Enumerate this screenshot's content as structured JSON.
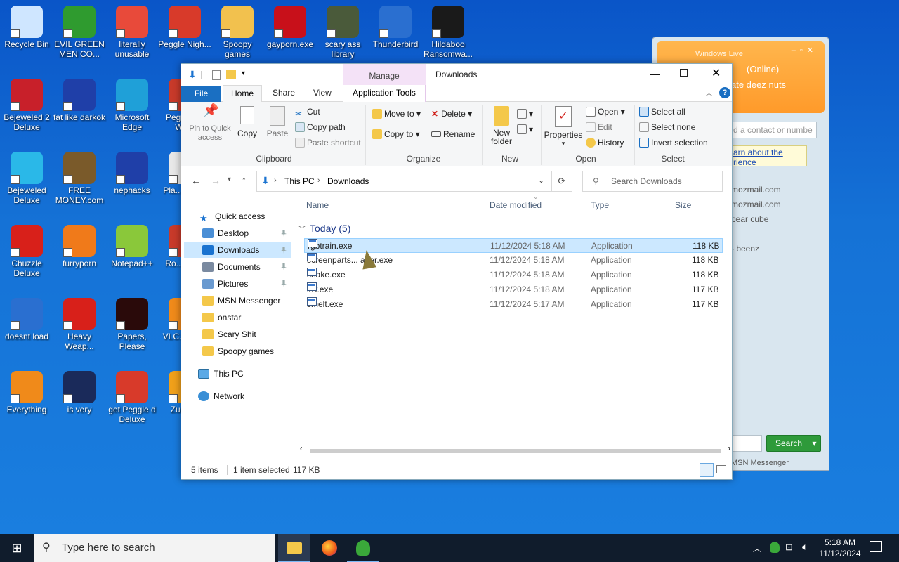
{
  "desktop": {
    "icons": [
      {
        "label": "Recycle Bin",
        "color": "#cfe6ff"
      },
      {
        "label": "EVIL GREEN MEN CO...",
        "color": "#2f9b2f"
      },
      {
        "label": "literally unusable",
        "color": "#e84a3a"
      },
      {
        "label": "Peggle Nigh...",
        "color": "#d83a2a"
      },
      {
        "label": "Spoopy games",
        "color": "#f2c14e"
      },
      {
        "label": "gayporn.exe",
        "color": "#c8101a"
      },
      {
        "label": "scary ass library",
        "color": "#4a5a3a"
      },
      {
        "label": "Thunderbird",
        "color": "#2a6fd0"
      },
      {
        "label": "Hildaboo Ransomwa...",
        "color": "#1a1a1a"
      },
      {
        "label": "Bejeweled 2 Deluxe",
        "color": "#c8202a"
      },
      {
        "label": "fat like darkok",
        "color": "#1f3fa8"
      },
      {
        "label": "Microsoft Edge",
        "color": "#1fa0d8"
      },
      {
        "label": "Peggl... of Wa...",
        "color": "#c83a2a"
      },
      {
        "label": "Bejeweled Deluxe",
        "color": "#2ab8e8"
      },
      {
        "label": "FREE MONEY.com",
        "color": "#7a5a2a"
      },
      {
        "label": "nephacks",
        "color": "#1f3fa8"
      },
      {
        "label": "Pla... Zon...",
        "color": "#e8e8e8"
      },
      {
        "label": "Chuzzle Deluxe",
        "color": "#d8201a"
      },
      {
        "label": "furryporn",
        "color": "#f07a1a"
      },
      {
        "label": "Notepad++",
        "color": "#8ac83a"
      },
      {
        "label": "Ro... Ma...",
        "color": "#c83a2a"
      },
      {
        "label": "doesnt load",
        "color": "#2a6fd0"
      },
      {
        "label": "Heavy Weap...",
        "color": "#d8201a"
      },
      {
        "label": "Papers, Please",
        "color": "#2a0a0a"
      },
      {
        "label": "VLC... pla...",
        "color": "#f08a1a"
      },
      {
        "label": "Everything",
        "color": "#f08a1a"
      },
      {
        "label": "is very",
        "color": "#1a2a5a"
      },
      {
        "label": "get Peggle d Deluxe",
        "color": "#d83a2a"
      },
      {
        "label": "Zuma...",
        "color": "#f0a01a"
      }
    ]
  },
  "msn": {
    "title": "Windows Live",
    "status": "(Online)",
    "personal_message": "ate deez nuts",
    "search_placeholder": "d a contact or numbe",
    "banner_line1": "arn about the",
    "banner_line2": "rience",
    "contacts": [
      "mozmail.com",
      "mozmail.com",
      "bear cube",
      "- beenz"
    ],
    "search_button": "Search",
    "footer": "MSN Messenger"
  },
  "explorer": {
    "title": "Downloads",
    "context_tab": "Manage",
    "tabs": [
      "File",
      "Home",
      "Share",
      "View",
      "Application Tools"
    ],
    "clipboard": {
      "pin": "Pin to Quick access",
      "copy": "Copy",
      "paste": "Paste",
      "cut": "Cut",
      "copy_path": "Copy path",
      "paste_shortcut": "Paste shortcut",
      "group": "Clipboard"
    },
    "organize": {
      "move_to": "Move to",
      "copy_to": "Copy to",
      "delete": "Delete",
      "rename": "Rename",
      "group": "Organize"
    },
    "new": {
      "new_folder": "New folder",
      "group": "New"
    },
    "open": {
      "properties": "Properties",
      "open": "Open",
      "edit": "Edit",
      "history": "History",
      "group": "Open"
    },
    "select": {
      "select_all": "Select all",
      "select_none": "Select none",
      "invert": "Invert selection",
      "group": "Select"
    },
    "address": {
      "crumb1": "This PC",
      "crumb2": "Downloads"
    },
    "search_placeholder": "Search Downloads",
    "nav": {
      "quick_access": "Quick access",
      "items": [
        "Desktop",
        "Downloads",
        "Documents",
        "Pictures",
        "MSN Messenger",
        "onstar",
        "Scary Shit",
        "Spoopy games"
      ],
      "this_pc": "This PC",
      "network": "Network"
    },
    "columns": [
      "Name",
      "Date modified",
      "Type",
      "Size"
    ],
    "group_header": "Today (5)",
    "files": [
      {
        "name": "rgbtrain.exe",
        "date": "11/12/2024 5:18 AM",
        "type": "Application",
        "size": "118 KB"
      },
      {
        "name": "screenparts... ader.exe",
        "date": "11/12/2024 5:18 AM",
        "type": "Application",
        "size": "118 KB"
      },
      {
        "name": "shake.exe",
        "date": "11/12/2024 5:18 AM",
        "type": "Application",
        "size": "118 KB"
      },
      {
        "name": "inv.exe",
        "date": "11/12/2024 5:18 AM",
        "type": "Application",
        "size": "117 KB"
      },
      {
        "name": "smelt.exe",
        "date": "11/12/2024 5:17 AM",
        "type": "Application",
        "size": "117 KB"
      }
    ],
    "status": {
      "count": "5 items",
      "selection": "1 item selected",
      "size": "117 KB"
    }
  },
  "taskbar": {
    "search_placeholder": "Type here to search",
    "time": "5:18 AM",
    "date": "11/12/2024"
  }
}
